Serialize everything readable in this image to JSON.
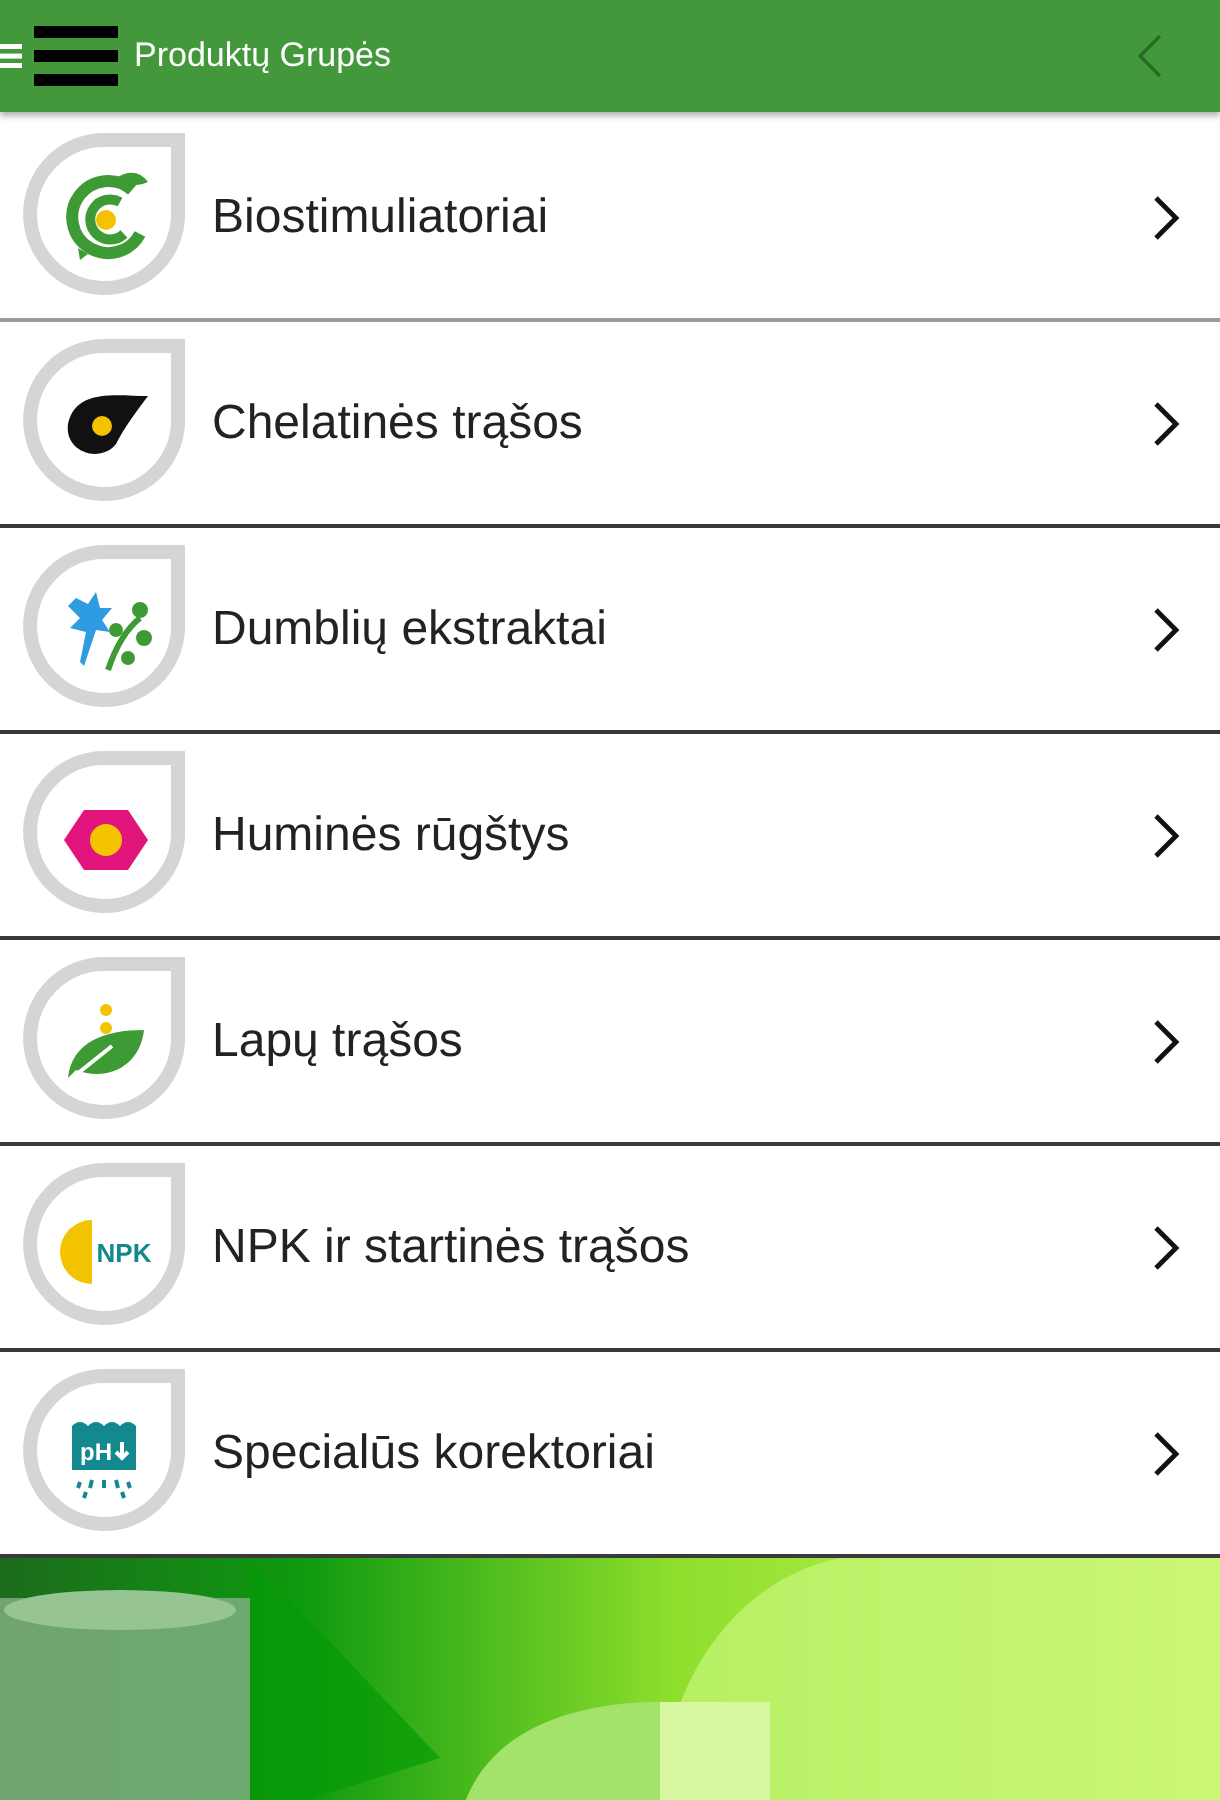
{
  "header": {
    "title": "Produktų Grupės"
  },
  "items": [
    {
      "label": "Biostimuliatoriai",
      "kind": "cycle"
    },
    {
      "label": "Chelatinės trąšos",
      "kind": "comet"
    },
    {
      "label": "Dumblių ekstraktai",
      "kind": "splash"
    },
    {
      "label": "Huminės rūgštys",
      "kind": "hexagon"
    },
    {
      "label": "Lapų trąšos",
      "kind": "leaf"
    },
    {
      "label": "NPK ir startinės trąšos",
      "kind": "npk",
      "icon_text": "NPK"
    },
    {
      "label": "Specialūs korektoriai",
      "kind": "ph",
      "icon_text": "pH"
    }
  ]
}
